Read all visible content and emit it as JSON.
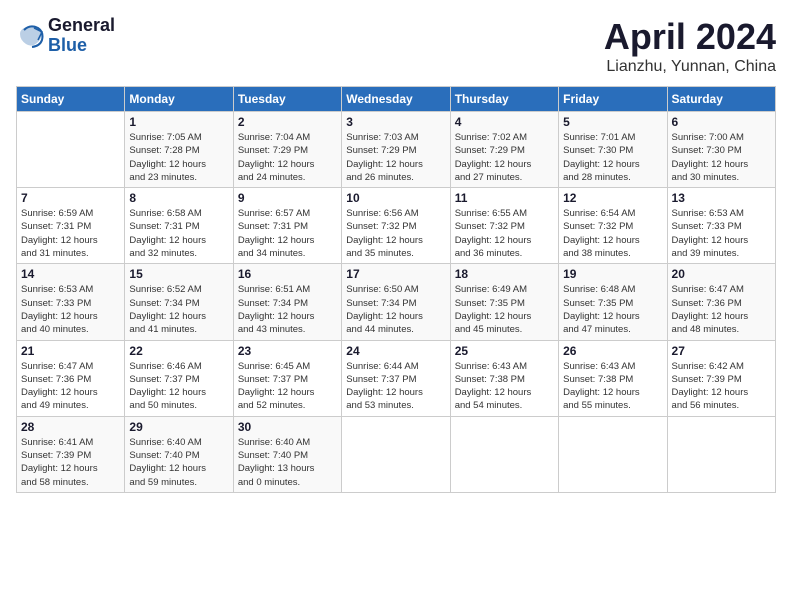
{
  "header": {
    "logo_general": "General",
    "logo_blue": "Blue",
    "title": "April 2024",
    "subtitle": "Lianzhu, Yunnan, China"
  },
  "columns": [
    "Sunday",
    "Monday",
    "Tuesday",
    "Wednesday",
    "Thursday",
    "Friday",
    "Saturday"
  ],
  "weeks": [
    [
      {
        "day": "",
        "info": ""
      },
      {
        "day": "1",
        "info": "Sunrise: 7:05 AM\nSunset: 7:28 PM\nDaylight: 12 hours\nand 23 minutes."
      },
      {
        "day": "2",
        "info": "Sunrise: 7:04 AM\nSunset: 7:29 PM\nDaylight: 12 hours\nand 24 minutes."
      },
      {
        "day": "3",
        "info": "Sunrise: 7:03 AM\nSunset: 7:29 PM\nDaylight: 12 hours\nand 26 minutes."
      },
      {
        "day": "4",
        "info": "Sunrise: 7:02 AM\nSunset: 7:29 PM\nDaylight: 12 hours\nand 27 minutes."
      },
      {
        "day": "5",
        "info": "Sunrise: 7:01 AM\nSunset: 7:30 PM\nDaylight: 12 hours\nand 28 minutes."
      },
      {
        "day": "6",
        "info": "Sunrise: 7:00 AM\nSunset: 7:30 PM\nDaylight: 12 hours\nand 30 minutes."
      }
    ],
    [
      {
        "day": "7",
        "info": "Sunrise: 6:59 AM\nSunset: 7:31 PM\nDaylight: 12 hours\nand 31 minutes."
      },
      {
        "day": "8",
        "info": "Sunrise: 6:58 AM\nSunset: 7:31 PM\nDaylight: 12 hours\nand 32 minutes."
      },
      {
        "day": "9",
        "info": "Sunrise: 6:57 AM\nSunset: 7:31 PM\nDaylight: 12 hours\nand 34 minutes."
      },
      {
        "day": "10",
        "info": "Sunrise: 6:56 AM\nSunset: 7:32 PM\nDaylight: 12 hours\nand 35 minutes."
      },
      {
        "day": "11",
        "info": "Sunrise: 6:55 AM\nSunset: 7:32 PM\nDaylight: 12 hours\nand 36 minutes."
      },
      {
        "day": "12",
        "info": "Sunrise: 6:54 AM\nSunset: 7:32 PM\nDaylight: 12 hours\nand 38 minutes."
      },
      {
        "day": "13",
        "info": "Sunrise: 6:53 AM\nSunset: 7:33 PM\nDaylight: 12 hours\nand 39 minutes."
      }
    ],
    [
      {
        "day": "14",
        "info": "Sunrise: 6:53 AM\nSunset: 7:33 PM\nDaylight: 12 hours\nand 40 minutes."
      },
      {
        "day": "15",
        "info": "Sunrise: 6:52 AM\nSunset: 7:34 PM\nDaylight: 12 hours\nand 41 minutes."
      },
      {
        "day": "16",
        "info": "Sunrise: 6:51 AM\nSunset: 7:34 PM\nDaylight: 12 hours\nand 43 minutes."
      },
      {
        "day": "17",
        "info": "Sunrise: 6:50 AM\nSunset: 7:34 PM\nDaylight: 12 hours\nand 44 minutes."
      },
      {
        "day": "18",
        "info": "Sunrise: 6:49 AM\nSunset: 7:35 PM\nDaylight: 12 hours\nand 45 minutes."
      },
      {
        "day": "19",
        "info": "Sunrise: 6:48 AM\nSunset: 7:35 PM\nDaylight: 12 hours\nand 47 minutes."
      },
      {
        "day": "20",
        "info": "Sunrise: 6:47 AM\nSunset: 7:36 PM\nDaylight: 12 hours\nand 48 minutes."
      }
    ],
    [
      {
        "day": "21",
        "info": "Sunrise: 6:47 AM\nSunset: 7:36 PM\nDaylight: 12 hours\nand 49 minutes."
      },
      {
        "day": "22",
        "info": "Sunrise: 6:46 AM\nSunset: 7:37 PM\nDaylight: 12 hours\nand 50 minutes."
      },
      {
        "day": "23",
        "info": "Sunrise: 6:45 AM\nSunset: 7:37 PM\nDaylight: 12 hours\nand 52 minutes."
      },
      {
        "day": "24",
        "info": "Sunrise: 6:44 AM\nSunset: 7:37 PM\nDaylight: 12 hours\nand 53 minutes."
      },
      {
        "day": "25",
        "info": "Sunrise: 6:43 AM\nSunset: 7:38 PM\nDaylight: 12 hours\nand 54 minutes."
      },
      {
        "day": "26",
        "info": "Sunrise: 6:43 AM\nSunset: 7:38 PM\nDaylight: 12 hours\nand 55 minutes."
      },
      {
        "day": "27",
        "info": "Sunrise: 6:42 AM\nSunset: 7:39 PM\nDaylight: 12 hours\nand 56 minutes."
      }
    ],
    [
      {
        "day": "28",
        "info": "Sunrise: 6:41 AM\nSunset: 7:39 PM\nDaylight: 12 hours\nand 58 minutes."
      },
      {
        "day": "29",
        "info": "Sunrise: 6:40 AM\nSunset: 7:40 PM\nDaylight: 12 hours\nand 59 minutes."
      },
      {
        "day": "30",
        "info": "Sunrise: 6:40 AM\nSunset: 7:40 PM\nDaylight: 13 hours\nand 0 minutes."
      },
      {
        "day": "",
        "info": ""
      },
      {
        "day": "",
        "info": ""
      },
      {
        "day": "",
        "info": ""
      },
      {
        "day": "",
        "info": ""
      }
    ]
  ]
}
